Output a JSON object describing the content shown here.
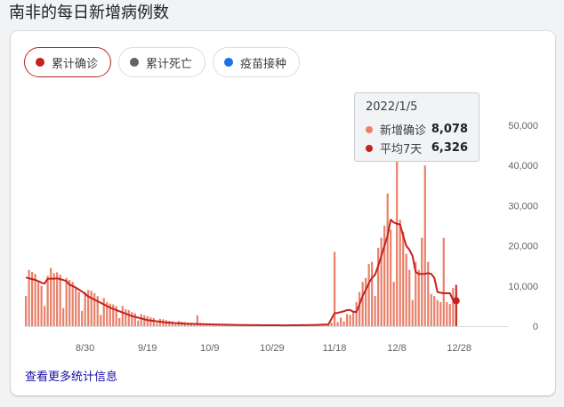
{
  "page": {
    "title": "南非的每日新增病例数"
  },
  "chips": [
    {
      "label": "累计确诊",
      "color": "#c5221f",
      "active": true
    },
    {
      "label": "累计死亡",
      "color": "#5f6368",
      "active": false
    },
    {
      "label": "疫苗接种",
      "color": "#1a73e8",
      "active": false
    }
  ],
  "tooltip": {
    "date": "2022/1/5",
    "rows": [
      {
        "label": "新增确诊",
        "value": "8,078",
        "color": "#e8806a"
      },
      {
        "label": "平均7天",
        "value": "6,326",
        "color": "#c5221f"
      }
    ]
  },
  "more_link": "查看更多统计信息",
  "chart_data": {
    "type": "bar",
    "x_labels": [
      "8/30",
      "9/19",
      "10/9",
      "10/29",
      "11/18",
      "12/8",
      "12/28"
    ],
    "y_ticks": [
      "0",
      "10,000",
      "20,000",
      "30,000",
      "40,000",
      "50,000"
    ],
    "ylim": [
      0,
      50000
    ],
    "start_date": "2021-08-11",
    "series": [
      {
        "name": "新增确诊",
        "type": "bar",
        "color": "#e8806a",
        "values": [
          7500,
          14000,
          13500,
          13000,
          11000,
          10000,
          5000,
          12500,
          14500,
          13200,
          13400,
          12800,
          4500,
          12000,
          11500,
          11000,
          9500,
          8500,
          3800,
          8500,
          9000,
          8800,
          8200,
          7500,
          2800,
          7000,
          6000,
          5600,
          5400,
          5000,
          2000,
          5000,
          4200,
          4000,
          3500,
          3200,
          1400,
          3000,
          2700,
          2500,
          2200,
          2000,
          800,
          1800,
          1700,
          1500,
          1300,
          1200,
          500,
          1300,
          1100,
          1000,
          900,
          850,
          300,
          2700,
          800,
          700,
          650,
          600,
          250,
          450,
          420,
          400,
          380,
          350,
          150,
          330,
          300,
          280,
          270,
          260,
          100,
          280,
          250,
          240,
          230,
          220,
          90,
          230,
          220,
          210,
          200,
          190,
          80,
          230,
          280,
          300,
          250,
          260,
          100,
          260,
          280,
          300,
          350,
          380,
          150,
          300,
          900,
          18500,
          1000,
          2100,
          1200,
          3000,
          2800,
          3500,
          6000,
          8500,
          11000,
          12000,
          15500,
          16000,
          7500,
          19500,
          22000,
          25000,
          33000,
          24000,
          11000,
          43000,
          26500,
          23500,
          18000,
          14000,
          6500,
          16000,
          14000,
          22000,
          40000,
          16000,
          8000,
          7500,
          6500,
          6000,
          22000,
          6000,
          5500,
          9500,
          8078
        ]
      },
      {
        "name": "平均7天",
        "type": "line",
        "color": "#c5221f",
        "values": [
          12100,
          11900,
          11700,
          11500,
          11200,
          10800,
          10600,
          11800,
          11800,
          11800,
          11900,
          11700,
          11500,
          11200,
          10300,
          10000,
          9600,
          9100,
          8600,
          8000,
          7400,
          7000,
          6600,
          6200,
          5800,
          5400,
          5000,
          4600,
          4300,
          4000,
          3700,
          3400,
          3100,
          2800,
          2500,
          2300,
          2100,
          1900,
          1700,
          1500,
          1400,
          1300,
          1200,
          1100,
          1000,
          900,
          850,
          800,
          750,
          700,
          650,
          600,
          580,
          560,
          540,
          520,
          500,
          480,
          460,
          440,
          420,
          400,
          385,
          370,
          355,
          340,
          325,
          310,
          300,
          290,
          280,
          270,
          260,
          250,
          245,
          240,
          235,
          230,
          225,
          220,
          215,
          210,
          205,
          200,
          200,
          210,
          220,
          230,
          240,
          250,
          260,
          270,
          280,
          300,
          320,
          350,
          380,
          400,
          1800,
          3200,
          3300,
          3500,
          3700,
          4000,
          4000,
          3600,
          3500,
          5400,
          7500,
          9000,
          10700,
          12000,
          12800,
          15000,
          17500,
          20000,
          22500,
          26500,
          25800,
          25500,
          25300,
          22500,
          20000,
          19000,
          17500,
          13500,
          13000,
          13000,
          13000,
          13200,
          13000,
          12000,
          8500,
          8300,
          8200,
          8200,
          8200,
          6500,
          6326
        ]
      }
    ]
  }
}
